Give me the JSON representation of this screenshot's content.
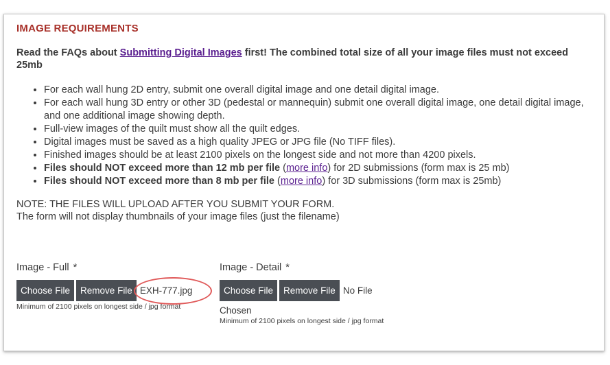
{
  "section": {
    "title": "IMAGE REQUIREMENTS"
  },
  "intro": {
    "prefix": "Read the FAQs about ",
    "link": "Submitting Digital Images",
    "suffix": " first! The combined total size of all your image files must not exceed 25mb"
  },
  "requirements": [
    {
      "text": "For each wall hung 2D entry, submit one overall digital image and one detail digital image."
    },
    {
      "text": "For each wall hung 3D entry or other 3D (pedestal or mannequin) submit one overall digital image, one detail digital image, and one additional image showing depth."
    },
    {
      "text": "Full-view images of the quilt must show all the quilt edges."
    },
    {
      "text": "Digital images must be saved as a high quality JPEG or JPG file (No TIFF files)."
    },
    {
      "text": "Finished images should be at least 2100 pixels on the longest side and not more than 4200 pixels."
    },
    {
      "bold": "Files should NOT exceed more than 12 mb per file",
      "pre": " (",
      "link": "more info",
      "post": ") for 2D submissions (form max is 25 mb)"
    },
    {
      "bold": "Files should NOT exceed more than 8 mb per file",
      "pre": " (",
      "link": "more info",
      "post": ") for 3D submissions (form max is 25mb)"
    }
  ],
  "note": {
    "line1": "NOTE: THE FILES WILL UPLOAD AFTER YOU SUBMIT YOUR FORM.",
    "line2": "The form will not display thumbnails of your image files (just the filename)"
  },
  "image_full": {
    "label": "Image - Full",
    "required_mark": "*",
    "choose_label": "Choose File",
    "remove_label": "Remove File",
    "filename": "EXH-777.jpg",
    "hint": "Minimum of 2100 pixels on longest side / jpg format"
  },
  "image_detail": {
    "label": "Image - Detail",
    "required_mark": "*",
    "choose_label": "Choose File",
    "remove_label": "Remove File",
    "filename": "No File",
    "filename_cont": "Chosen",
    "hint": "Minimum of 2100 pixels on longest side / jpg format"
  },
  "colors": {
    "title": "#a8312a",
    "link": "#5a1f8f",
    "button_bg": "#4a4e54",
    "annotation_ring": "#e05a5a"
  }
}
